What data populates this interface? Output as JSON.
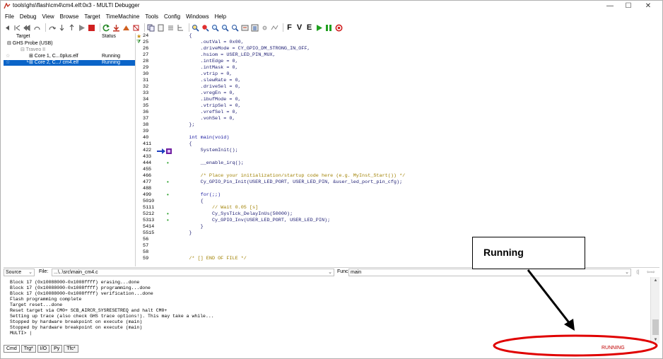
{
  "window": {
    "title": "tools\\ghs\\flash\\cm4\\cm4.elf:0x3 - MULTI Debugger",
    "minimize": "—",
    "maximize": "☐",
    "close": "✕"
  },
  "menu": [
    "File",
    "Debug",
    "View",
    "Browse",
    "Target",
    "TimeMachine",
    "Tools",
    "Config",
    "Windows",
    "Help"
  ],
  "toolbar": {
    "letters": [
      "F",
      "V",
      "E"
    ]
  },
  "target_pane": {
    "col_target": "Target",
    "col_status": "Status",
    "rows": [
      {
        "name": "⊟ GHS Probe (USB)",
        "status": ""
      },
      {
        "name": "⊟ Traveo II",
        "status": ""
      },
      {
        "name": "⊞ Core 1, C...0plus.elf",
        "status": "Running"
      },
      {
        "name": "└⊞ Core 2, C.../ cm4.elf",
        "status": "Running"
      }
    ]
  },
  "source": {
    "lines": [
      {
        "n": "24",
        "b": "",
        "d": "",
        "code": "    {"
      },
      {
        "n": "25",
        "b": "",
        "d": "",
        "code": "        .outVal = 0x00,"
      },
      {
        "n": "26",
        "b": "",
        "d": "",
        "code": "        .driveMode = CY_GPIO_DM_STRONG_IN_OFF,"
      },
      {
        "n": "27",
        "b": "",
        "d": "",
        "code": "        .hsiom = USER_LED_PIN_MUX,"
      },
      {
        "n": "28",
        "b": "",
        "d": "",
        "code": "        .intEdge = 0,"
      },
      {
        "n": "29",
        "b": "",
        "d": "",
        "code": "        .intMask = 0,"
      },
      {
        "n": "30",
        "b": "",
        "d": "",
        "code": "        .vtrip = 0,"
      },
      {
        "n": "31",
        "b": "",
        "d": "",
        "code": "        .slewRate = 0,"
      },
      {
        "n": "32",
        "b": "",
        "d": "",
        "code": "        .driveSel = 0,"
      },
      {
        "n": "33",
        "b": "",
        "d": "",
        "code": "        .vregEn = 0,"
      },
      {
        "n": "34",
        "b": "",
        "d": "",
        "code": "        .ibufMode = 0,"
      },
      {
        "n": "35",
        "b": "",
        "d": "",
        "code": "        .vtripSel = 0,"
      },
      {
        "n": "36",
        "b": "",
        "d": "",
        "code": "        .vrefSel = 0,"
      },
      {
        "n": "37",
        "b": "",
        "d": "",
        "code": "        .vohSel = 0,"
      },
      {
        "n": "38",
        "b": "",
        "d": "",
        "code": "    };"
      },
      {
        "n": "39",
        "b": "",
        "d": "",
        "code": ""
      },
      {
        "n": "40",
        "b": "",
        "d": "",
        "code": "    int main(void)"
      },
      {
        "n": "41",
        "b": "1",
        "d": "",
        "code": "    {"
      },
      {
        "n": "42",
        "b": "2",
        "d": "",
        "code": "        SystemInit();"
      },
      {
        "n": "43",
        "b": "3",
        "d": "",
        "code": ""
      },
      {
        "n": "44",
        "b": "4",
        "d": "•",
        "code": "        __enable_irq();"
      },
      {
        "n": "45",
        "b": "5",
        "d": "",
        "code": ""
      },
      {
        "n": "46",
        "b": "6",
        "d": "",
        "code": "        /* Place your initialization/startup code here (e.g. MyInst_Start()) */"
      },
      {
        "n": "47",
        "b": "7",
        "d": "•",
        "code": "        Cy_GPIO_Pin_Init(USER_LED_PORT, USER_LED_PIN, &user_led_port_pin_cfg);"
      },
      {
        "n": "48",
        "b": "8",
        "d": "",
        "code": ""
      },
      {
        "n": "49",
        "b": "9",
        "d": "•",
        "code": "        for(;;)"
      },
      {
        "n": "50",
        "b": "10",
        "d": "",
        "code": "        {"
      },
      {
        "n": "51",
        "b": "11",
        "d": "",
        "code": "            // Wait 0.05 [s]"
      },
      {
        "n": "52",
        "b": "12",
        "d": "•",
        "code": "            Cy_SysTick_DelayInUs(50000);"
      },
      {
        "n": "53",
        "b": "13",
        "d": "•",
        "code": "            Cy_GPIO_Inv(USER_LED_PORT, USER_LED_PIN);"
      },
      {
        "n": "54",
        "b": "14",
        "d": "",
        "code": "        }"
      },
      {
        "n": "55",
        "b": "15",
        "d": "",
        "code": "    }"
      },
      {
        "n": "56",
        "b": "",
        "d": "",
        "code": ""
      },
      {
        "n": "57",
        "b": "",
        "d": "",
        "code": ""
      },
      {
        "n": "58",
        "b": "",
        "d": "",
        "code": ""
      },
      {
        "n": "59",
        "b": "",
        "d": "",
        "code": "    /* [] END OF FILE */"
      }
    ]
  },
  "srcbar": {
    "mode": "Source",
    "file_label": "File:",
    "file": "...\\..\\src\\main_cm4.c",
    "func_label": "Func:",
    "func": "main"
  },
  "command": {
    "lines": [
      "Block 17 (0x10088000-0x1008ffff) erasing...done",
      "Block 17 (0x10088000-0x1008ffff) programming...done",
      "Block 17 (0x10088000-0x1008ffff) verification...done",
      "Flash programming complete",
      "Target reset...done",
      "Reset target via CM0+ SCB_AIRCR_SYSRESETREQ and halt CM0+",
      "Setting up trace (also check GHS trace options!). This may take a while...",
      "Stopped by hardware breakpoint on execute (main)",
      "Stopped by hardware breakpoint on execute (main)",
      "MULTI> |"
    ]
  },
  "tabs": [
    "Cmd",
    "Trg*",
    "I/O",
    "Py",
    "Tfc*"
  ],
  "status": "RUNNING",
  "annotation": {
    "label": "Running",
    "color": "#e00000"
  }
}
